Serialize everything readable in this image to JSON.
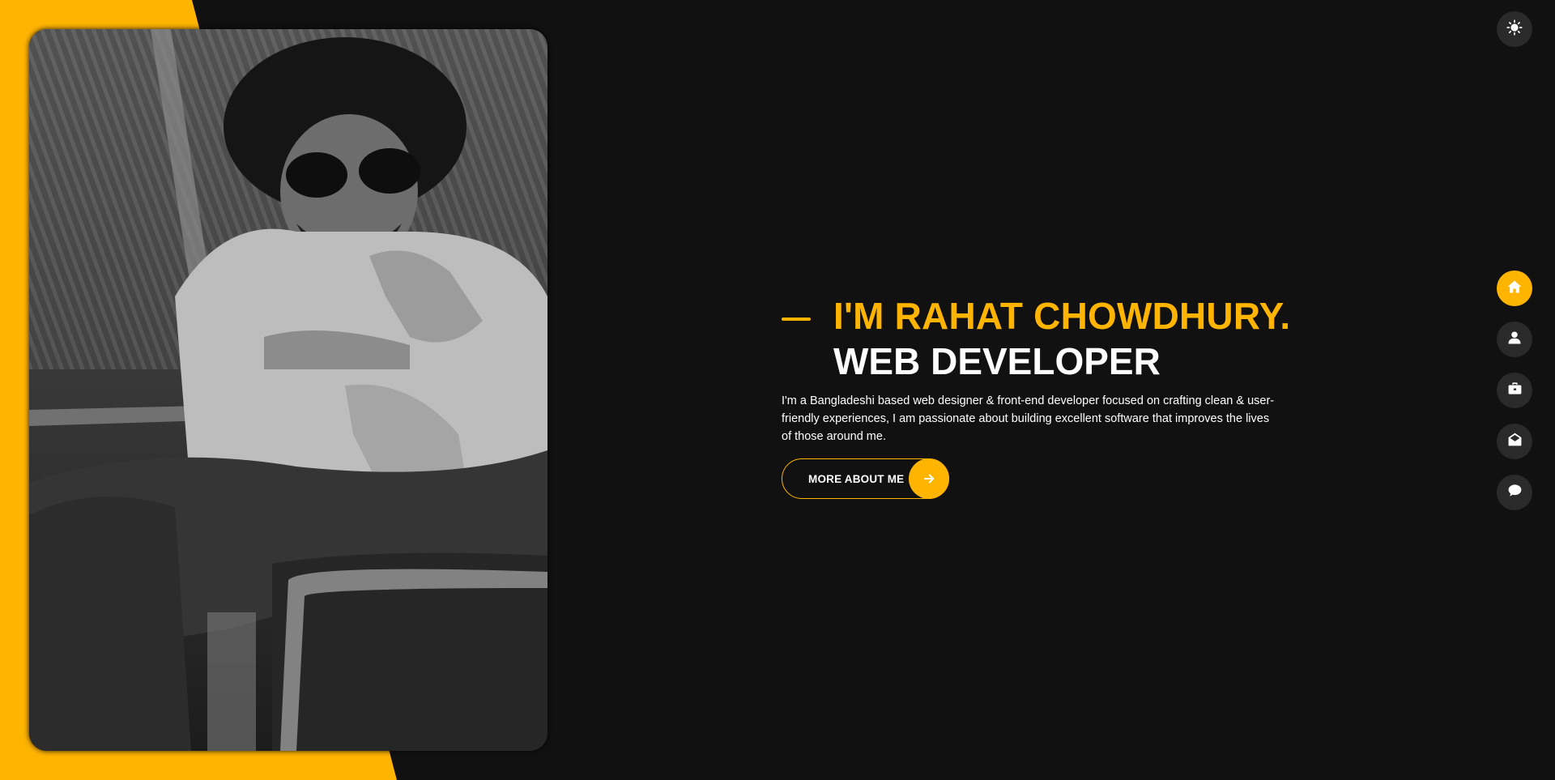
{
  "hero": {
    "name_line": "I'M RAHAT CHOWDHURY.",
    "role_line": "WEB DEVELOPER",
    "intro": "I'm a Bangladeshi based web designer & front-end developer focused on crafting clean & user-friendly experiences, I am passionate about building excellent software that improves the lives of those around me.",
    "cta_label": "MORE ABOUT ME"
  },
  "colors": {
    "accent": "#ffb400",
    "background": "#111111",
    "icon_button_bg": "#2b2a2a",
    "text": "#ffffff"
  },
  "icons": {
    "theme_toggle": "sun-icon",
    "cta_arrow": "arrow-right-icon",
    "nav": [
      "home-icon",
      "user-icon",
      "briefcase-icon",
      "envelope-open-icon",
      "comment-icon"
    ]
  },
  "nav": {
    "active_item": "home"
  }
}
